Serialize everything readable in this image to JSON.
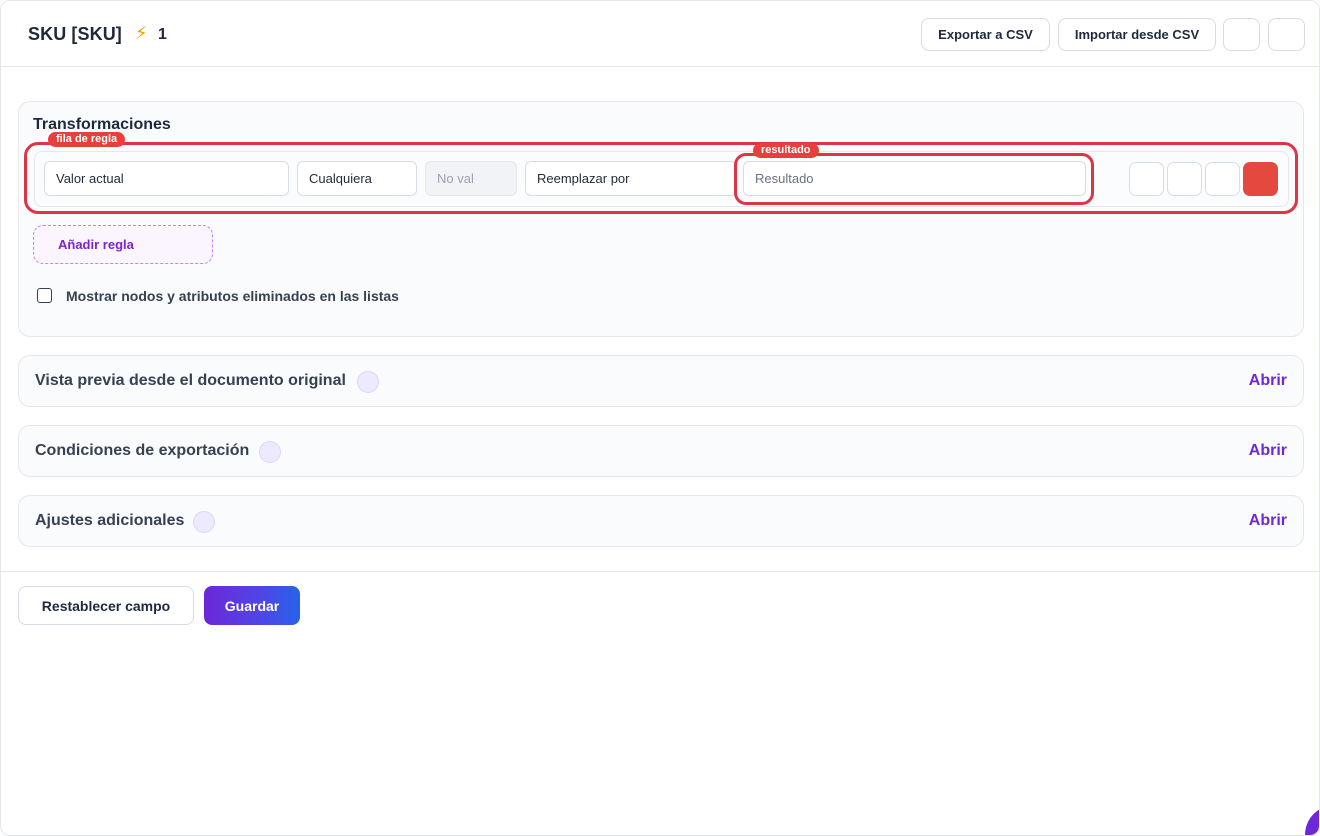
{
  "header": {
    "title": "SKU [SKU]",
    "bolt_icon": "⚡",
    "count": "1",
    "export_label": "Exportar a CSV",
    "import_label": "Importar desde CSV"
  },
  "transformations": {
    "title": "Transformaciones",
    "rule": {
      "source": "Valor actual",
      "condition": "Cualquiera",
      "value_placeholder": "No val",
      "action": "Reemplazar por",
      "result_placeholder": "Resultado"
    },
    "add_rule_label": "Añadir regla",
    "show_deleted_label": "Mostrar nodos y atributos eliminados en las listas"
  },
  "annotations": {
    "row_tag": "fila de regla",
    "result_tag": "resultado",
    "color": "#dc3545"
  },
  "sections": [
    {
      "title": "Vista previa desde el documento original",
      "action": "Abrir"
    },
    {
      "title": "Condiciones de exportación",
      "action": "Abrir"
    },
    {
      "title": "Ajustes adicionales",
      "action": "Abrir"
    }
  ],
  "footer": {
    "reset_label": "Restablecer campo",
    "save_label": "Guardar"
  },
  "colors": {
    "accent": "#6d28d9",
    "delete_red": "#e5483f"
  }
}
